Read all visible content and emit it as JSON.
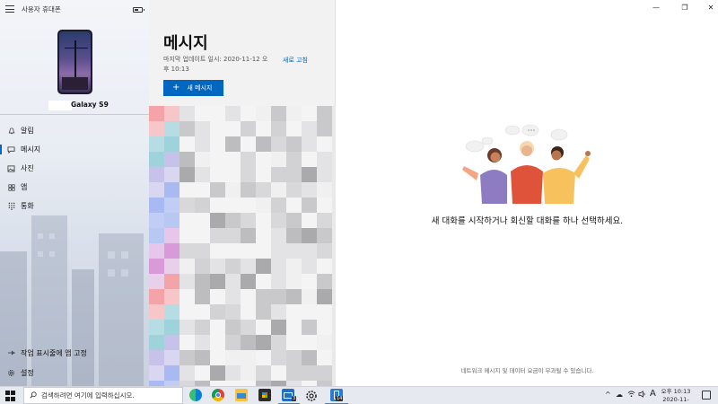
{
  "sidebar": {
    "app_title": "사용자 휴대폰",
    "device_name": "Galaxy S9",
    "nav": [
      {
        "label": "알림",
        "icon": "bell-icon"
      },
      {
        "label": "메시지",
        "icon": "message-icon"
      },
      {
        "label": "사진",
        "icon": "photo-icon"
      },
      {
        "label": "앱",
        "icon": "apps-icon"
      },
      {
        "label": "통화",
        "icon": "dialpad-icon"
      }
    ],
    "pin_label": "작업 표시줄에 앱 고정",
    "settings_label": "설정"
  },
  "list": {
    "title": "메시지",
    "last_update": "마지막 업데이트 일시: 2020-11-12 오후 10:13",
    "refresh": "새로 고침",
    "new_message": "새 메시지"
  },
  "main": {
    "empty_text": "새 대화를 시작하거나 회신할 대화를 하나 선택하세요.",
    "footer_note": "네트워크 메시지 및 데이터 요금이 부과될 수 있습니다."
  },
  "taskbar": {
    "search_placeholder": "검색하려면 여기에 입력하십시오.",
    "mail_badge": "3",
    "phone_badge": "14",
    "ime": "A",
    "time": "오후 10:13",
    "date": "2020-11-12"
  },
  "colors": {
    "accent": "#0067c0"
  }
}
